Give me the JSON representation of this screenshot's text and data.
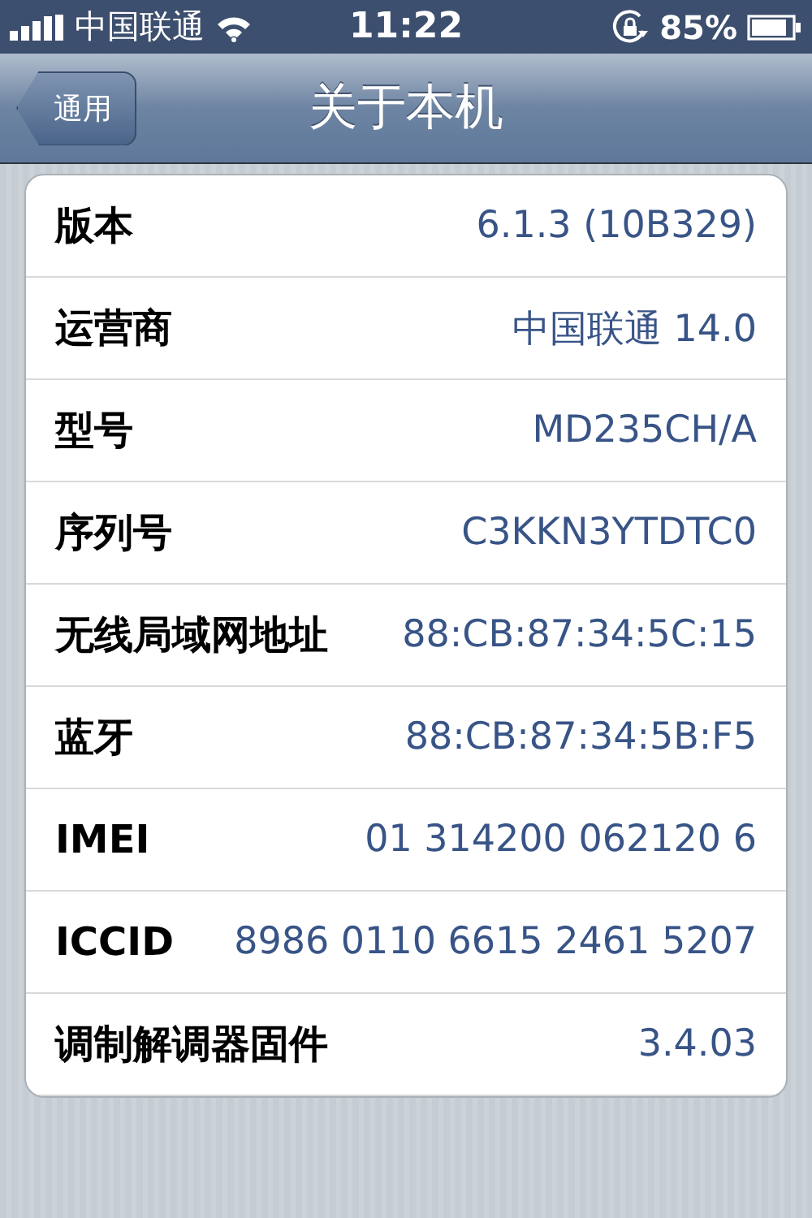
{
  "status_bar": {
    "carrier": "中国联通",
    "time": "11:22",
    "battery": "85%"
  },
  "nav_bar": {
    "back": "通用",
    "title": "关于本机"
  },
  "rows": [
    {
      "label": "版本",
      "value": "6.1.3 (10B329)"
    },
    {
      "label": "运营商",
      "value": "中国联通 14.0"
    },
    {
      "label": "型号",
      "value": "MD235CH/A"
    },
    {
      "label": "序列号",
      "value": "C3KKN3YTDTC0"
    },
    {
      "label": "无线局域网地址",
      "value": "88:CB:87:34:5C:15"
    },
    {
      "label": "蓝牙",
      "value": "88:CB:87:34:5B:F5"
    },
    {
      "label": "IMEI",
      "value": "01 314200 062120 6"
    },
    {
      "label": "ICCID",
      "value": "8986 0110 6615 2461 5207"
    },
    {
      "label": "调制解调器固件",
      "value": "3.4.03"
    }
  ]
}
